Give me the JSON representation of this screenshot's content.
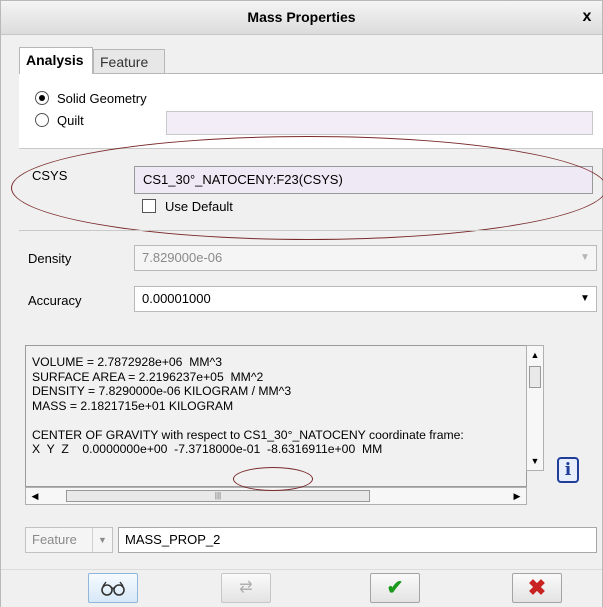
{
  "window": {
    "title": "Mass Properties",
    "close_glyph": "x"
  },
  "tabs": [
    {
      "label": "Analysis",
      "active": true
    },
    {
      "label": "Feature",
      "active": false
    }
  ],
  "geometry": {
    "options": [
      {
        "label": "Solid Geometry",
        "selected": true
      },
      {
        "label": "Quilt",
        "selected": false
      }
    ],
    "quilt_value": ""
  },
  "csys": {
    "label": "CSYS",
    "value": "CS1_30°_NATOCENY:F23(CSYS)",
    "use_default_label": "Use Default",
    "use_default_checked": false
  },
  "density": {
    "label": "Density",
    "value": "7.829000e-06"
  },
  "accuracy": {
    "label": "Accuracy",
    "value": "0.00001000"
  },
  "results": {
    "lines": [
      "VOLUME = 2.7872928e+06  MM^3",
      "SURFACE AREA = 2.2196237e+05  MM^2",
      "DENSITY = 7.8290000e-06 KILOGRAM / MM^3",
      "MASS = 2.1821715e+01 KILOGRAM",
      "",
      "CENTER OF GRAVITY with respect to CS1_30°_NATOCENY coordinate frame:",
      "X  Y  Z    0.0000000e+00  -7.3718000e-01  -8.6316911e+00  MM"
    ]
  },
  "feature": {
    "type_label": "Feature",
    "name": "MASS_PROP_2"
  },
  "icons": {
    "info": "info-icon",
    "glasses": "glasses-icon",
    "regenerate": "regenerate-icon",
    "ok": "checkmark-icon",
    "cancel": "cancel-x-icon"
  },
  "colors": {
    "annotation": "#7a2a2a",
    "ok": "#1b9a1b",
    "cancel": "#c82222",
    "info": "#1f3f9a"
  }
}
